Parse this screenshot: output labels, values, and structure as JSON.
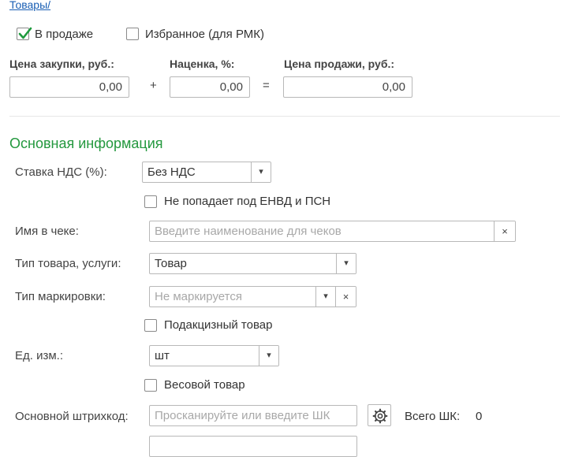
{
  "breadcrumb": "Товары/",
  "flags": {
    "on_sale_label": "В продаже",
    "on_sale_checked": true,
    "favorite_label": "Избранное (для РМК)",
    "favorite_checked": false
  },
  "prices": {
    "purchase_label": "Цена закупки, руб.:",
    "purchase_value": "0,00",
    "plus_sign": "+",
    "markup_label": "Наценка, %:",
    "markup_value": "0,00",
    "equals_sign": "=",
    "sale_label": "Цена продажи, руб.:",
    "sale_value": "0,00"
  },
  "section_title": "Основная информация",
  "form": {
    "vat_label": "Ставка НДС (%):",
    "vat_value": "Без НДС",
    "envd_label": "Не попадает под ЕНВД и ПСН",
    "receipt_name_label": "Имя в чеке:",
    "receipt_name_placeholder": "Введите наименование для чеков",
    "item_type_label": "Тип товара, услуги:",
    "item_type_value": "Товар",
    "marking_label": "Тип маркировки:",
    "marking_placeholder": "Не маркируется",
    "excise_label": "Подакцизный товар",
    "unit_label": "Ед. изм.:",
    "unit_value": "шт",
    "weight_label": "Весовой товар",
    "barcode_label": "Основной штрихкод:",
    "barcode_placeholder": "Просканируйте или введите ШК",
    "barcode_total_label": "Всего ШК:",
    "barcode_total_value": "0"
  },
  "icons": {
    "dropdown": "chevron-down-icon",
    "clear": "close-icon",
    "settings": "gear-icon",
    "check": "checkmark-icon"
  },
  "colors": {
    "section_title": "#23983e",
    "checkmark": "#1f9a3e",
    "link": "#1a5fb4"
  }
}
